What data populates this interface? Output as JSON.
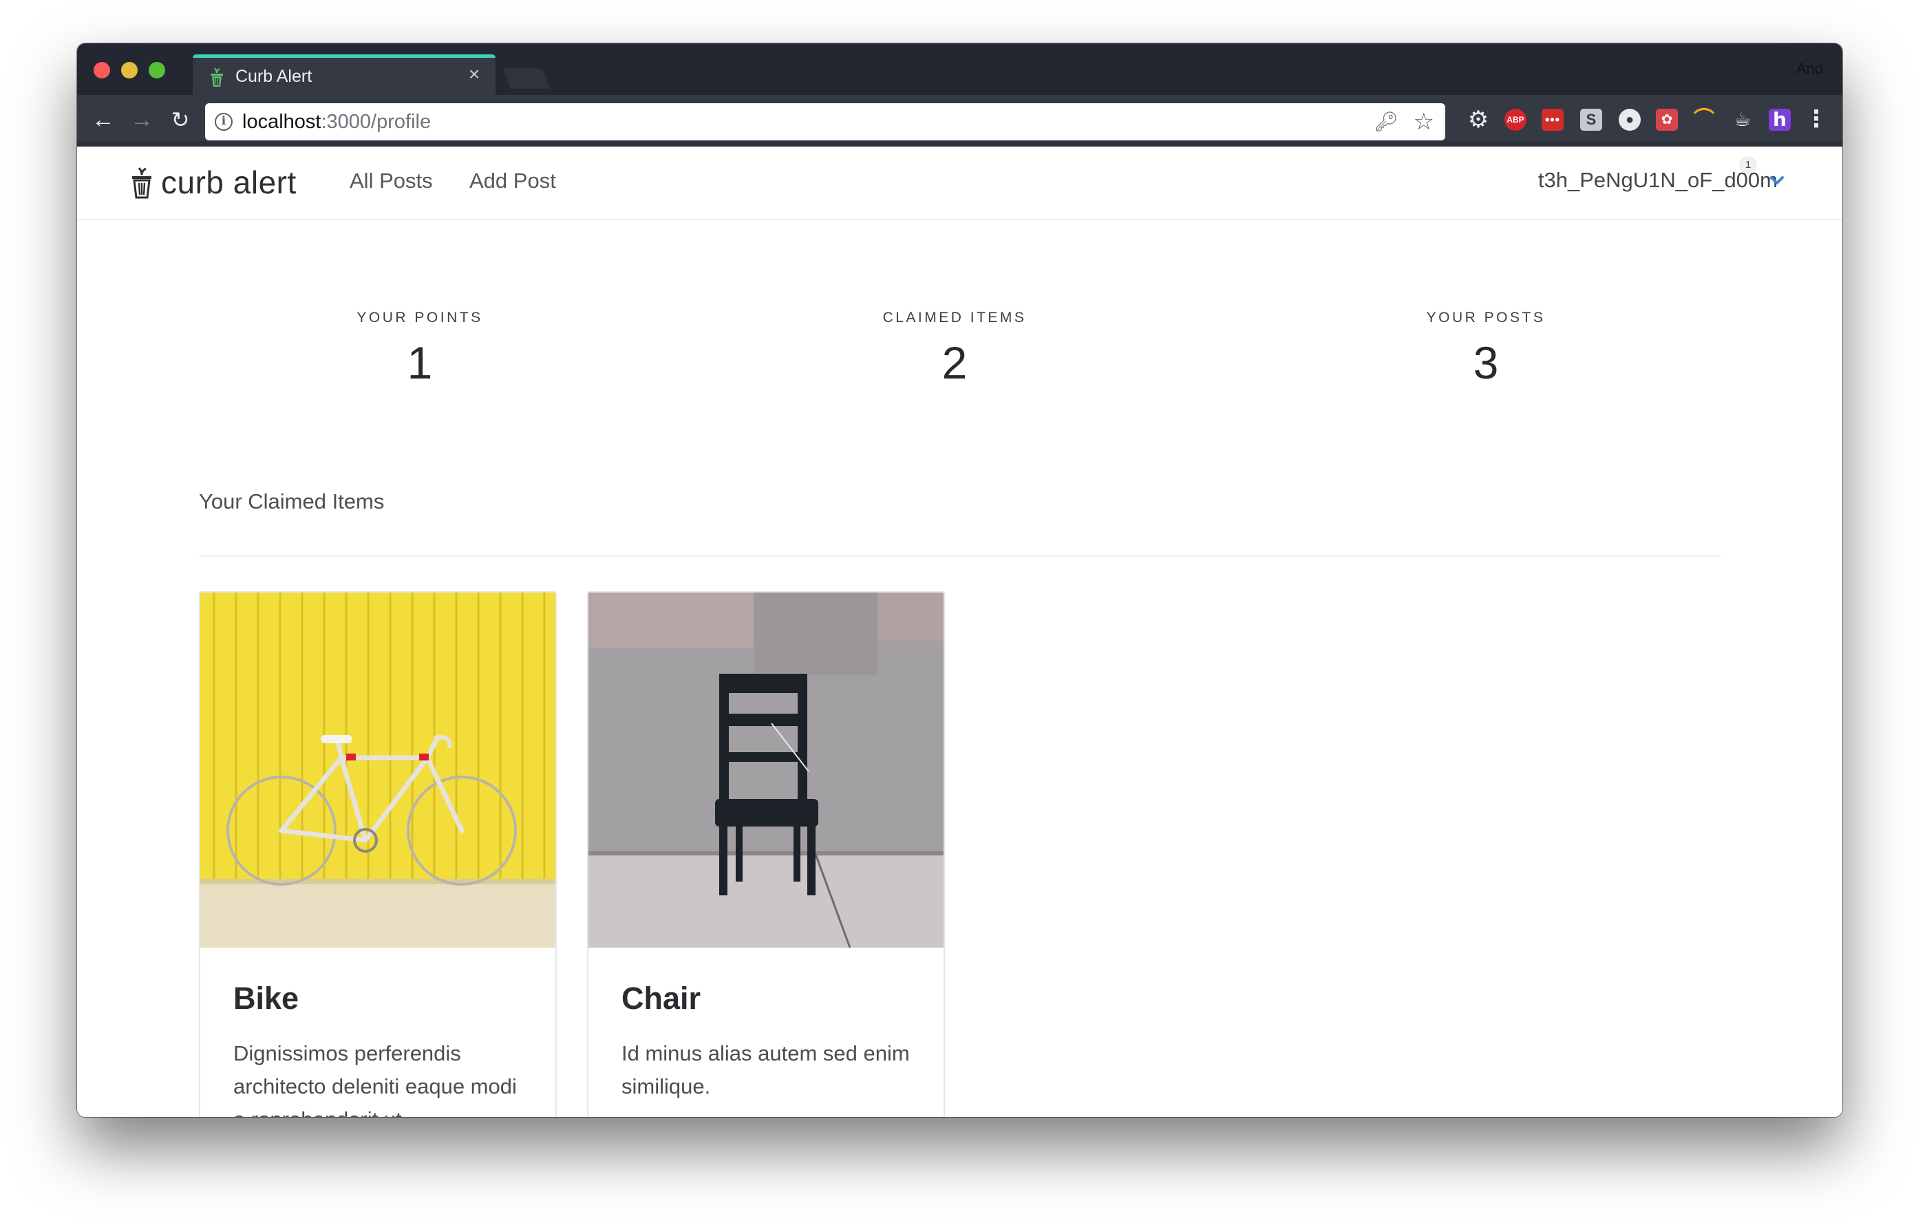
{
  "browser": {
    "tab_title": "Curb Alert",
    "tab_close": "×",
    "profile_name": "And",
    "url_host": "localhost",
    "url_rest": ":3000/profile",
    "extensions": {
      "abp": "ABP",
      "lastpass": "•••",
      "s": "S",
      "h": "h"
    }
  },
  "app": {
    "brand": "curb alert",
    "nav": {
      "all_posts": "All Posts",
      "add_post": "Add Post"
    },
    "user": {
      "username": "t3h_PeNgU1N_oF_d00m",
      "badge_count": "1"
    }
  },
  "stats": [
    {
      "label": "YOUR POINTS",
      "value": "1"
    },
    {
      "label": "CLAIMED ITEMS",
      "value": "2"
    },
    {
      "label": "YOUR POSTS",
      "value": "3"
    }
  ],
  "claimed": {
    "section_title": "Your Claimed Items",
    "items": [
      {
        "title": "Bike",
        "description": "Dignissimos perferendis architecto deleniti eaque modi a reprehenderit ut"
      },
      {
        "title": "Chair",
        "description": "Id minus alias autem sed enim similique."
      }
    ]
  },
  "colors": {
    "tab_accent": "#3fd1b4",
    "chrome_dark": "#222731",
    "chrome_toolbar": "#343944",
    "bike_wall": "#f3dd3a",
    "chair_wall": "#9a9698",
    "chevron": "#3d86d8"
  }
}
